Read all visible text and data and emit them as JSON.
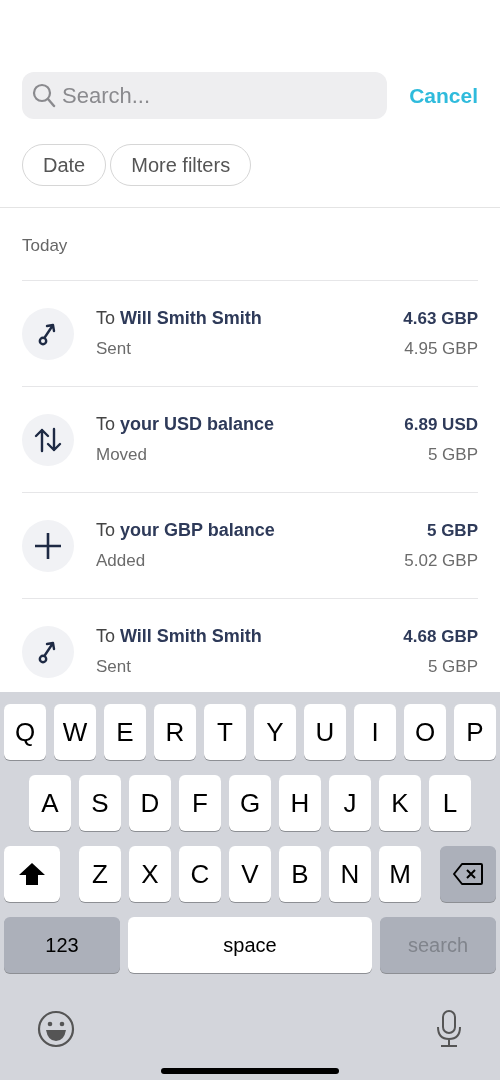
{
  "search": {
    "placeholder": "Search..."
  },
  "cancel": "Cancel",
  "filters": [
    "Date",
    "More filters"
  ],
  "section": "Today",
  "transactions": [
    {
      "kind": "sent",
      "title": "To **Will Smith Smith**",
      "status": "Sent",
      "amount": "4.63 GBP",
      "source_amount": "4.95 GBP"
    },
    {
      "kind": "moved",
      "title": "To **your USD balance**",
      "status": "Moved",
      "amount": "6.89 USD",
      "source_amount": "5 GBP"
    },
    {
      "kind": "added",
      "title": "To **your GBP balance**",
      "status": "Added",
      "amount": "5 GBP",
      "source_amount": "5.02 GBP"
    },
    {
      "kind": "sent",
      "title": "To **Will Smith Smith**",
      "status": "Sent",
      "amount": "4.68 GBP",
      "source_amount": "5 GBP"
    }
  ],
  "keyboard": {
    "letter_rows": [
      [
        {
          "kind": "letter",
          "label": "Q"
        },
        {
          "kind": "letter",
          "label": "W"
        },
        {
          "kind": "letter",
          "label": "E"
        },
        {
          "kind": "letter",
          "label": "R"
        },
        {
          "kind": "letter",
          "label": "T"
        },
        {
          "kind": "letter",
          "label": "Y"
        },
        {
          "kind": "letter",
          "label": "U"
        },
        {
          "kind": "letter",
          "label": "I"
        },
        {
          "kind": "letter",
          "label": "O"
        },
        {
          "kind": "letter",
          "label": "P"
        }
      ],
      [
        {
          "kind": "letter",
          "label": "A"
        },
        {
          "kind": "letter",
          "label": "S"
        },
        {
          "kind": "letter",
          "label": "D"
        },
        {
          "kind": "letter",
          "label": "F"
        },
        {
          "kind": "letter",
          "label": "G"
        },
        {
          "kind": "letter",
          "label": "H"
        },
        {
          "kind": "letter",
          "label": "J"
        },
        {
          "kind": "letter",
          "label": "K"
        },
        {
          "kind": "letter",
          "label": "L"
        }
      ],
      [
        {
          "kind": "shift"
        },
        {
          "kind": "letter",
          "label": "Z"
        },
        {
          "kind": "letter",
          "label": "X"
        },
        {
          "kind": "letter",
          "label": "C"
        },
        {
          "kind": "letter",
          "label": "V"
        },
        {
          "kind": "letter",
          "label": "B"
        },
        {
          "kind": "letter",
          "label": "N"
        },
        {
          "kind": "letter",
          "label": "M"
        },
        {
          "kind": "backspace"
        }
      ]
    ],
    "bottom_row": [
      {
        "kind": "mode",
        "label": "123"
      },
      {
        "kind": "space",
        "label": "space"
      },
      {
        "kind": "action",
        "label": "search"
      }
    ]
  }
}
